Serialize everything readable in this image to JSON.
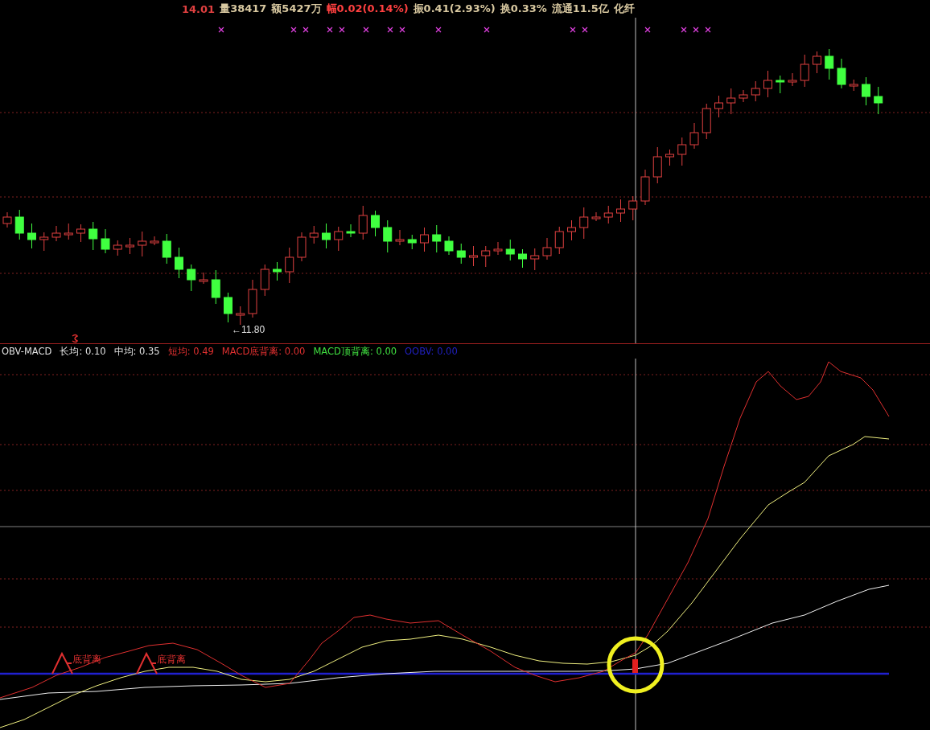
{
  "info_bar": [
    {
      "text": "14.01",
      "color": "#e04040"
    },
    {
      "text": "量38417",
      "color": "#d8c8a0"
    },
    {
      "text": "额5427万",
      "color": "#d8c8a0"
    },
    {
      "text": "幅0.02(0.14%)",
      "color": "#ff4040"
    },
    {
      "text": "振0.41(2.93%)",
      "color": "#d8c8a0"
    },
    {
      "text": "换0.33%",
      "color": "#d8c8a0"
    },
    {
      "text": "流通11.5亿",
      "color": "#d8c8a0"
    },
    {
      "text": "化纤",
      "color": "#d8c8a0"
    }
  ],
  "price_panel": {
    "low_label": "←11.80"
  },
  "indicator_legend": [
    {
      "text": "OBV-MACD",
      "color": "#e0e0e0"
    },
    {
      "text": "长均: 0.10",
      "color": "#e0e0e0"
    },
    {
      "text": "中均: 0.35",
      "color": "#e0e0e0"
    },
    {
      "text": "短均: 0.49",
      "color": "#e03030"
    },
    {
      "text": "MACD底背离: 0.00",
      "color": "#e03030"
    },
    {
      "text": "MACD顶背离: 0.00",
      "color": "#40e040"
    },
    {
      "text": "OOBV: 0.00",
      "color": "#2020c0"
    }
  ],
  "indicator_panel": {
    "divergence_labels": [
      "底背离",
      "底背离"
    ]
  }
}
